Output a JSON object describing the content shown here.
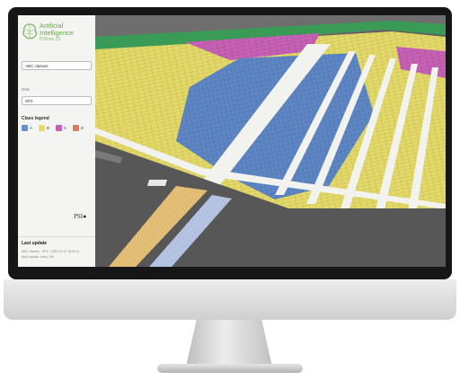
{
  "app": {
    "logo_line1": "Artificial",
    "logo_line2": "Intelligence",
    "logo_line3": "PSIneo 25"
  },
  "sidebar": {
    "selector_value": "ABC classes",
    "field_label": "Grid",
    "field_value": "SP2",
    "legend_title": "Class legend",
    "legend": [
      {
        "label": "A",
        "color": "#6b8fc9"
      },
      {
        "label": "B",
        "color": "#e8dc6a"
      },
      {
        "label": "C",
        "color": "#c860b4"
      },
      {
        "label": "D",
        "color": "#e07a5f"
      }
    ],
    "partner_logo": "PSI●"
  },
  "last_update": {
    "title": "Last update",
    "line1": "ABC classes · SP2 · 2020-01-11 18:00:11",
    "line2": "Next update: every 24h"
  },
  "colors": {
    "class_a": "#5f86c4",
    "class_b": "#e3d86a",
    "class_c": "#c761b5",
    "class_d": "#e07a5f",
    "aisle": "#f2f2ee",
    "floor": "#5c5c5c",
    "fence": "#3a9b57"
  }
}
